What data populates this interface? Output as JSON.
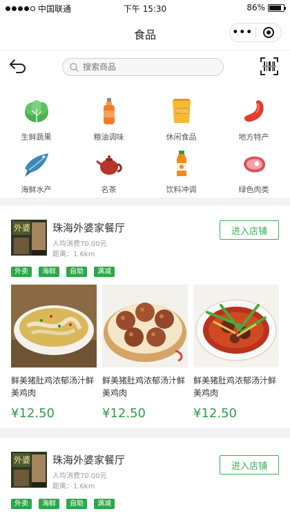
{
  "status_bar": {
    "carrier": "中国联通",
    "time": "下午 15:30",
    "battery": "86%",
    "battery_level": 0.86
  },
  "nav": {
    "title": "食品",
    "more_icon": "more-dots-icon",
    "close_icon": "target-circle-icon"
  },
  "search": {
    "placeholder": "搜索商品",
    "back_icon": "back-arrow-icon",
    "scan_icon": "barcode-scan-icon"
  },
  "categories": [
    {
      "label": "生鲜蔬果",
      "icon": "vegetable-icon"
    },
    {
      "label": "粮油调味",
      "icon": "oil-bottle-icon"
    },
    {
      "label": "休闲食品",
      "icon": "snack-bag-icon"
    },
    {
      "label": "地方特产",
      "icon": "sausage-icon"
    },
    {
      "label": "海鲜水产",
      "icon": "fish-icon"
    },
    {
      "label": "名茶",
      "icon": "teapot-icon"
    },
    {
      "label": "饮料冲调",
      "icon": "drink-bottle-icon"
    },
    {
      "label": "绿色肉类",
      "icon": "meat-icon"
    }
  ],
  "shops": [
    {
      "name": "珠海外婆家餐厅",
      "avg_cost": "人均消费70.00元",
      "distance": "距离：1.6km",
      "enter_label": "进入店铺",
      "tags": [
        "外卖",
        "海鲜",
        "自助",
        "满减"
      ],
      "dishes": [
        {
          "name": "鲜美猪肚鸡浓郁汤汁鲜美鸡肉",
          "price": "¥12.50"
        },
        {
          "name": "鲜美猪肚鸡浓郁汤汁鲜美鸡肉",
          "price": "¥12.50"
        },
        {
          "name": "鲜美猪肚鸡浓郁汤汁鲜美鸡肉",
          "price": "¥12.50"
        }
      ]
    },
    {
      "name": "珠海外婆家餐厅",
      "avg_cost": "人均消费70.00元",
      "distance": "距离：1.6km",
      "enter_label": "进入店铺",
      "tags": [
        "外卖",
        "海鲜",
        "自助",
        "满减"
      ]
    }
  ],
  "colors": {
    "accent": "#35b04f",
    "price": "#2e9c48",
    "tag_bg": "#2aa84a"
  }
}
